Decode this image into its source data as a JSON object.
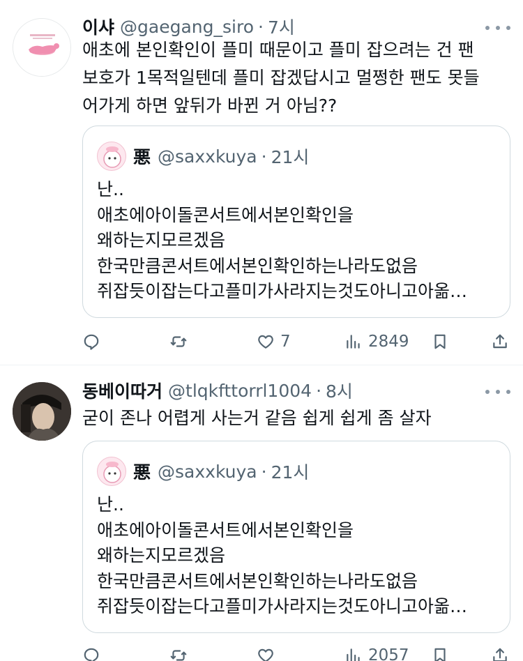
{
  "tweets": [
    {
      "display_name": "이샤",
      "handle": "@gaegang_siro",
      "separator": "·",
      "time": "7시",
      "text_lines": [
        "애초에 본인확인이 플미 때문이고 플미 잡으려는 건 팬",
        "보호가 1목적일텐데 플미 잡겠답시고 멀쩡한 팬도 못들",
        "어가게 하면 앞뒤가 바뀐 거 아님??"
      ],
      "quote": {
        "display_name": "悪",
        "handle": "@saxxkuya",
        "separator": "·",
        "time": "21시",
        "text_lines": [
          "난..",
          "애초에아이돌콘서트에서본인확인을",
          "왜하는지모르겠음",
          "한국만큼콘서트에서본인확인하는나라도없음",
          "쥐잡듯이잡는다고플미가사라지는것도아니고아옮…"
        ]
      },
      "stats": {
        "replies": "",
        "retweets": "",
        "likes": "7",
        "views": "2849"
      }
    },
    {
      "display_name": "동베이따거",
      "handle": "@tlqkfttorrl1004",
      "separator": "·",
      "time": "8시",
      "text_lines": [
        "굳이 존나 어렵게 사는거 같음 쉽게 쉽게 좀 살자"
      ],
      "quote": {
        "display_name": "悪",
        "handle": "@saxxkuya",
        "separator": "·",
        "time": "21시",
        "text_lines": [
          "난..",
          "애초에아이돌콘서트에서본인확인을",
          "왜하는지모르겠음",
          "한국만큼콘서트에서본인확인하는나라도없음",
          "쥐잡듯이잡는다고플미가사라지는것도아니고아옮…"
        ]
      },
      "stats": {
        "replies": "",
        "retweets": "",
        "likes": "",
        "views": "2057"
      }
    }
  ],
  "icons": {
    "reply": "reply-icon",
    "retweet": "retweet-icon",
    "like": "heart-icon",
    "views": "views-icon",
    "bookmark": "bookmark-icon",
    "share": "share-icon",
    "more": "more-icon"
  },
  "colors": {
    "text": "#0f1419",
    "secondary": "#536471",
    "border": "#cfd9de",
    "divider": "#eff3f4"
  }
}
